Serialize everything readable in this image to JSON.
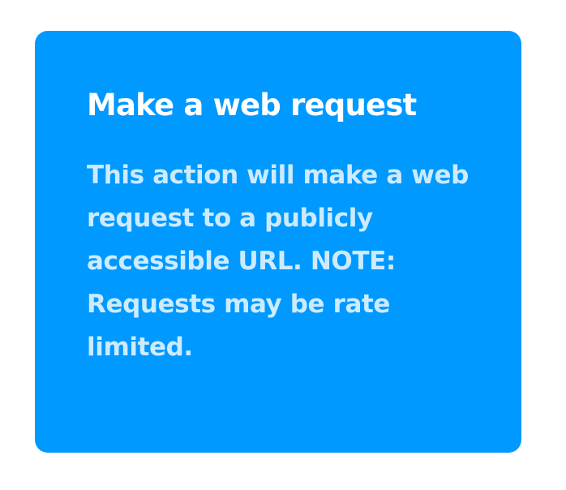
{
  "colors": {
    "page_background": "#FFFFFF",
    "card_background": "#0099FF",
    "title_text": "#FFFFFF",
    "description_text": "#CCEBFF"
  },
  "action_card": {
    "title": "Make a web request",
    "description": "This action will make a web request to a publicly accessible URL. NOTE: Requests may be rate limited."
  }
}
